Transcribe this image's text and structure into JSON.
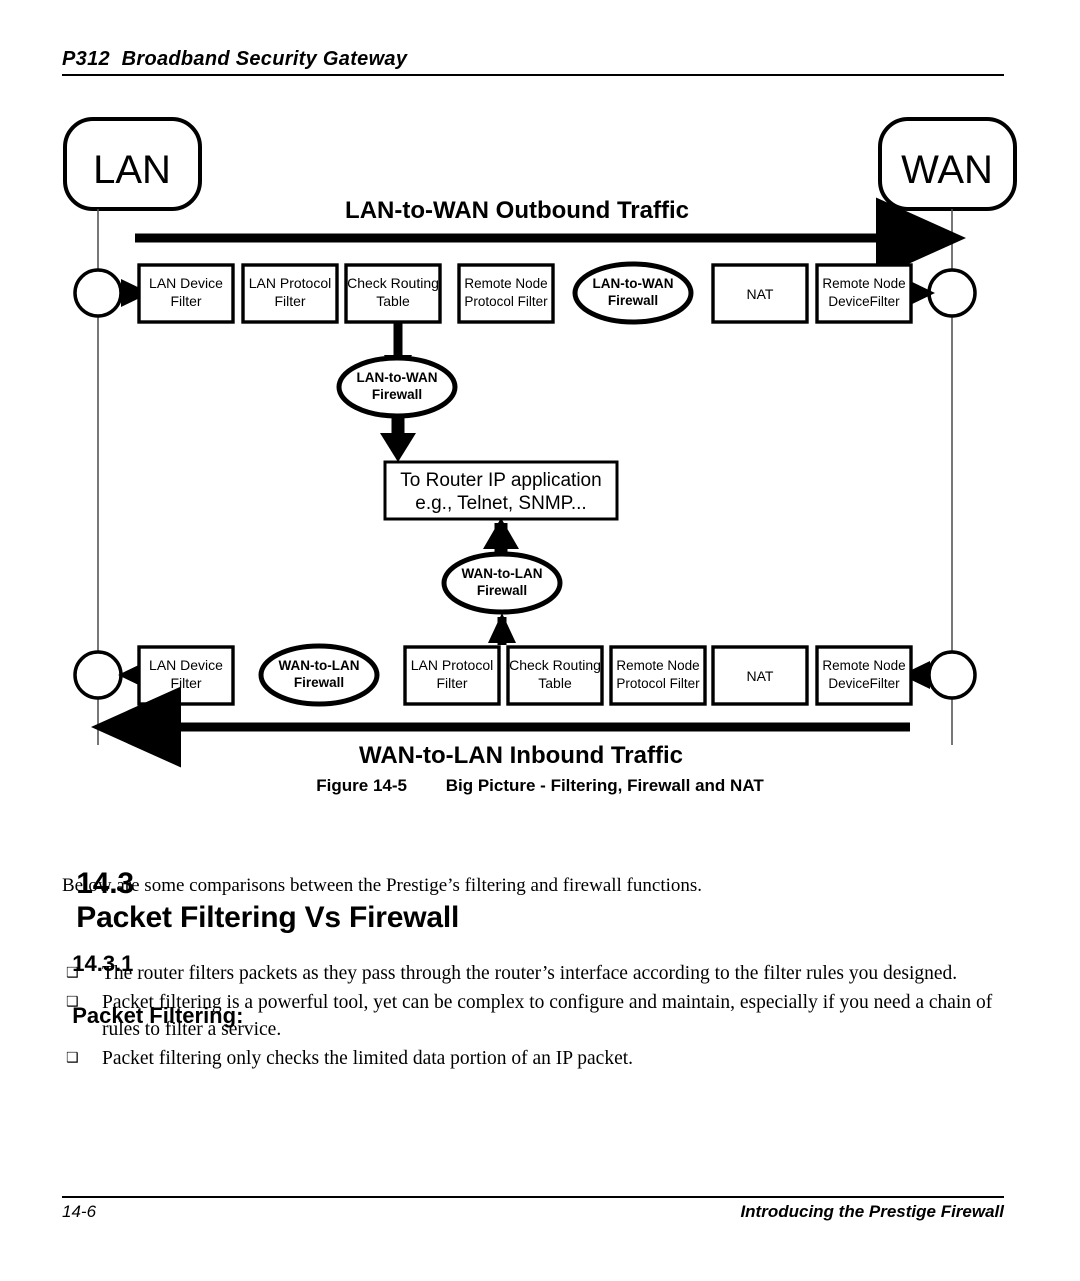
{
  "header": {
    "title": "P312  Broadband Security Gateway"
  },
  "figure": {
    "caption_number": "Figure 14-5",
    "caption_text": "Big Picture - Filtering, Firewall and NAT",
    "endpoints": {
      "lan": "LAN",
      "wan": "WAN"
    },
    "flow_labels": {
      "outbound": "LAN-to-WAN Outbound Traffic",
      "inbound": "WAN-to-LAN Inbound Traffic"
    },
    "top_row": [
      {
        "line1": "LAN Device",
        "line2": "Filter",
        "shape": "rect"
      },
      {
        "line1": "LAN Protocol",
        "line2": "Filter",
        "shape": "rect"
      },
      {
        "line1": "Check Routing",
        "line2": "Table",
        "shape": "rect"
      },
      {
        "line1": "Remote Node",
        "line2": "Protocol Filter",
        "shape": "rect"
      },
      {
        "line1": "LAN-to-WAN",
        "line2": "Firewall",
        "shape": "oval"
      },
      {
        "line1": "NAT",
        "line2": "",
        "shape": "rect"
      },
      {
        "line1": "Remote Node",
        "line2": "DeviceFilter",
        "shape": "rect"
      }
    ],
    "bottom_row": [
      {
        "line1": "LAN Device",
        "line2": "Filter",
        "shape": "rect"
      },
      {
        "line1": "WAN-to-LAN",
        "line2": "Firewall",
        "shape": "oval"
      },
      {
        "line1": "LAN Protocol",
        "line2": "Filter",
        "shape": "rect"
      },
      {
        "line1": "Check Routing",
        "line2": "Table",
        "shape": "rect"
      },
      {
        "line1": "Remote Node",
        "line2": "Protocol Filter",
        "shape": "rect"
      },
      {
        "line1": "NAT",
        "line2": "",
        "shape": "rect"
      },
      {
        "line1": "Remote Node",
        "line2": "DeviceFilter",
        "shape": "rect"
      }
    ],
    "middle": {
      "upper_oval_line1": "LAN-to-WAN",
      "upper_oval_line2": "Firewall",
      "router_box_line1": "To Router IP application",
      "router_box_line2": "e.g., Telnet, SNMP...",
      "lower_oval_line1": "WAN-to-LAN",
      "lower_oval_line2": "Firewall"
    },
    "colors": {
      "stroke": "#000000",
      "fill": "#ffffff"
    }
  },
  "sections": {
    "s143_number": "14.3",
    "s143_title": "Packet Filtering Vs Firewall",
    "s143_intro": "Below are some comparisons between the Prestige’s filtering and firewall functions.",
    "s1431_number": "14.3.1",
    "s1431_title": "Packet Filtering:"
  },
  "bullets": {
    "marker": "❑",
    "items": [
      "The router filters packets as they pass through the router’s interface according to the filter rules you designed.",
      "Packet filtering is a powerful tool, yet can be complex to configure and maintain, especially if you need a chain of rules to filter a service.",
      "Packet filtering only checks the limited data portion of an IP packet."
    ]
  },
  "footer": {
    "page_number": "14-6",
    "running_title": "Introducing the Prestige Firewall"
  }
}
